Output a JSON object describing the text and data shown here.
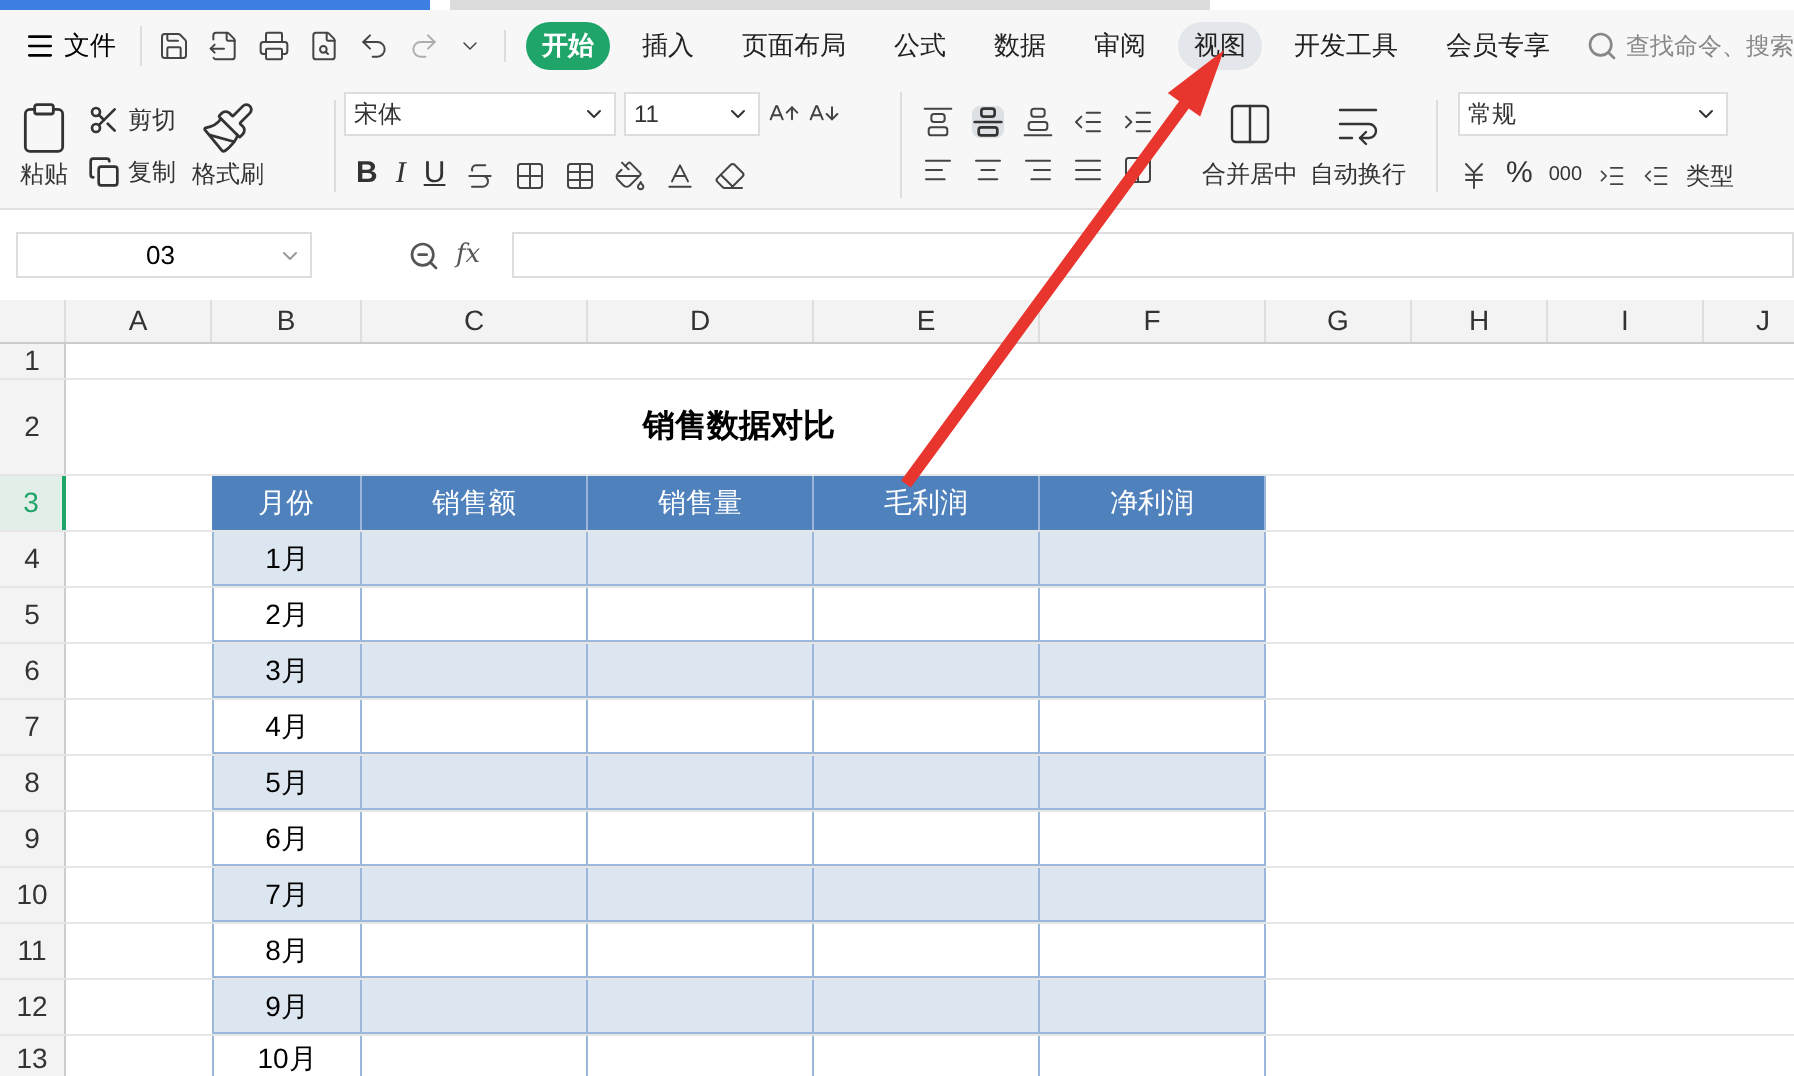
{
  "menu": {
    "file_label": "文件",
    "tabs": [
      {
        "label": "开始",
        "selected": true,
        "highlighted": false
      },
      {
        "label": "插入",
        "selected": false,
        "highlighted": false
      },
      {
        "label": "页面布局",
        "selected": false,
        "highlighted": false
      },
      {
        "label": "公式",
        "selected": false,
        "highlighted": false
      },
      {
        "label": "数据",
        "selected": false,
        "highlighted": false
      },
      {
        "label": "审阅",
        "selected": false,
        "highlighted": false
      },
      {
        "label": "视图",
        "selected": false,
        "highlighted": true
      },
      {
        "label": "开发工具",
        "selected": false,
        "highlighted": false
      },
      {
        "label": "会员专享",
        "selected": false,
        "highlighted": false
      }
    ],
    "search_placeholder": "查找命令、搜索"
  },
  "ribbon": {
    "paste": "粘贴",
    "cut": "剪切",
    "copy": "复制",
    "format_painter": "格式刷",
    "font_name": "宋体",
    "font_size": "11",
    "bold": "B",
    "italic": "I",
    "underline": "U",
    "merge": "合并居中",
    "wrap": "自动换行",
    "number_format": "常规",
    "percent": "%",
    "thousands": "000",
    "convert": "类型"
  },
  "formula_bar": {
    "name_box": "03",
    "fx": "fx"
  },
  "sheet": {
    "columns": [
      "A",
      "B",
      "C",
      "D",
      "E",
      "F",
      "G",
      "H",
      "I",
      "J"
    ],
    "rows": [
      {
        "label": "1",
        "selected": false
      },
      {
        "label": "2",
        "selected": false
      },
      {
        "label": "3",
        "selected": true
      },
      {
        "label": "4",
        "selected": false
      },
      {
        "label": "5",
        "selected": false
      },
      {
        "label": "6",
        "selected": false
      },
      {
        "label": "7",
        "selected": false
      },
      {
        "label": "8",
        "selected": false
      },
      {
        "label": "9",
        "selected": false
      },
      {
        "label": "10",
        "selected": false
      },
      {
        "label": "11",
        "selected": false
      },
      {
        "label": "12",
        "selected": false
      },
      {
        "label": "13",
        "selected": false
      }
    ],
    "title": "销售数据对比",
    "headers": [
      "月份",
      "销售额",
      "销售量",
      "毛利润",
      "净利润"
    ],
    "months": [
      "1月",
      "2月",
      "3月",
      "4月",
      "5月",
      "6月",
      "7月",
      "8月",
      "9月",
      "10月"
    ]
  }
}
